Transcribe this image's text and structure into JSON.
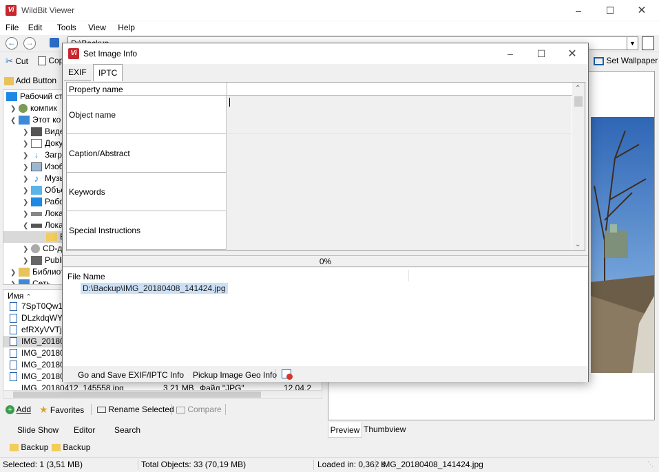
{
  "app": {
    "title": "WildBit Viewer",
    "icon_text": "Vi"
  },
  "menu": [
    "File",
    "Edit",
    "Tools",
    "View",
    "Help"
  ],
  "nav": {
    "path": "D:\\Backup"
  },
  "toolbar": {
    "cut": "Cut",
    "copy": "Cop",
    "set_wallpaper": "Set Wallpaper",
    "add_button": "Add Button"
  },
  "tree": [
    {
      "label": "Рабочий стс",
      "icon": "desktop-icon"
    },
    {
      "label": "компик",
      "icon": "user-icon"
    },
    {
      "label": "Этот ко",
      "icon": "computer-icon"
    },
    {
      "label": "Виде",
      "icon": "video-icon"
    },
    {
      "label": "Доку",
      "icon": "documents-icon"
    },
    {
      "label": "Загр",
      "icon": "download-icon"
    },
    {
      "label": "Изоб",
      "icon": "pictures-icon"
    },
    {
      "label": "Музы",
      "icon": "music-icon"
    },
    {
      "label": "Объе",
      "icon": "3d-objects-icon"
    },
    {
      "label": "Рабо",
      "icon": "desktop-icon"
    },
    {
      "label": "Лока",
      "icon": "drive-icon"
    },
    {
      "label": "Лока",
      "icon": "drive-icon"
    },
    {
      "label": "В",
      "icon": "folder-icon"
    },
    {
      "label": "CD-д",
      "icon": "cd-icon"
    },
    {
      "label": "Publi",
      "icon": "network-icon"
    },
    {
      "label": "Библиот",
      "icon": "library-icon"
    },
    {
      "label": "Сеть",
      "icon": "network-icon"
    }
  ],
  "filelist": {
    "header": "Имя",
    "rows": [
      "7SpT0Qw1M",
      "DLzkdqWYe",
      "efRXyVVTjg",
      "IMG_20180",
      "IMG_20180",
      "IMG_20180",
      "IMG_20180"
    ],
    "partial_row": {
      "name": "IMG_20180412_145558.jpg",
      "size": "3,21 MB",
      "type": "Файл \"JPG\"",
      "date": "12.04.2"
    }
  },
  "bottom_buttons": {
    "add": "Add",
    "favorites": "Favorites",
    "rename": "Rename Selected",
    "compare": "Compare"
  },
  "view_tabs": [
    "Slide Show",
    "Editor",
    "Search"
  ],
  "crumbs": [
    "Backup",
    "Backup"
  ],
  "preview_tabs": [
    "Preview",
    "Thumbview"
  ],
  "status": {
    "selected": "Selected: 1 (3,51 MB)",
    "total": "Total Objects: 33 (70,19 MB)",
    "loaded": "Loaded in: 0,362 s",
    "file": "IMG_20180408_141424.jpg"
  },
  "dialog": {
    "title": "Set Image Info",
    "tabs": [
      "EXIF",
      "IPTC"
    ],
    "grid_header": "Property name",
    "properties": [
      "Object name",
      "Caption/Abstract",
      "Keywords",
      "Special Instructions"
    ],
    "progress": "0%",
    "file_header": "File Name",
    "file_value": "D:\\Backup\\IMG_20180408_141424.jpg",
    "btn_save": "Go and Save EXIF/IPTC Info",
    "btn_geo": "Pickup Image Geo Info"
  }
}
